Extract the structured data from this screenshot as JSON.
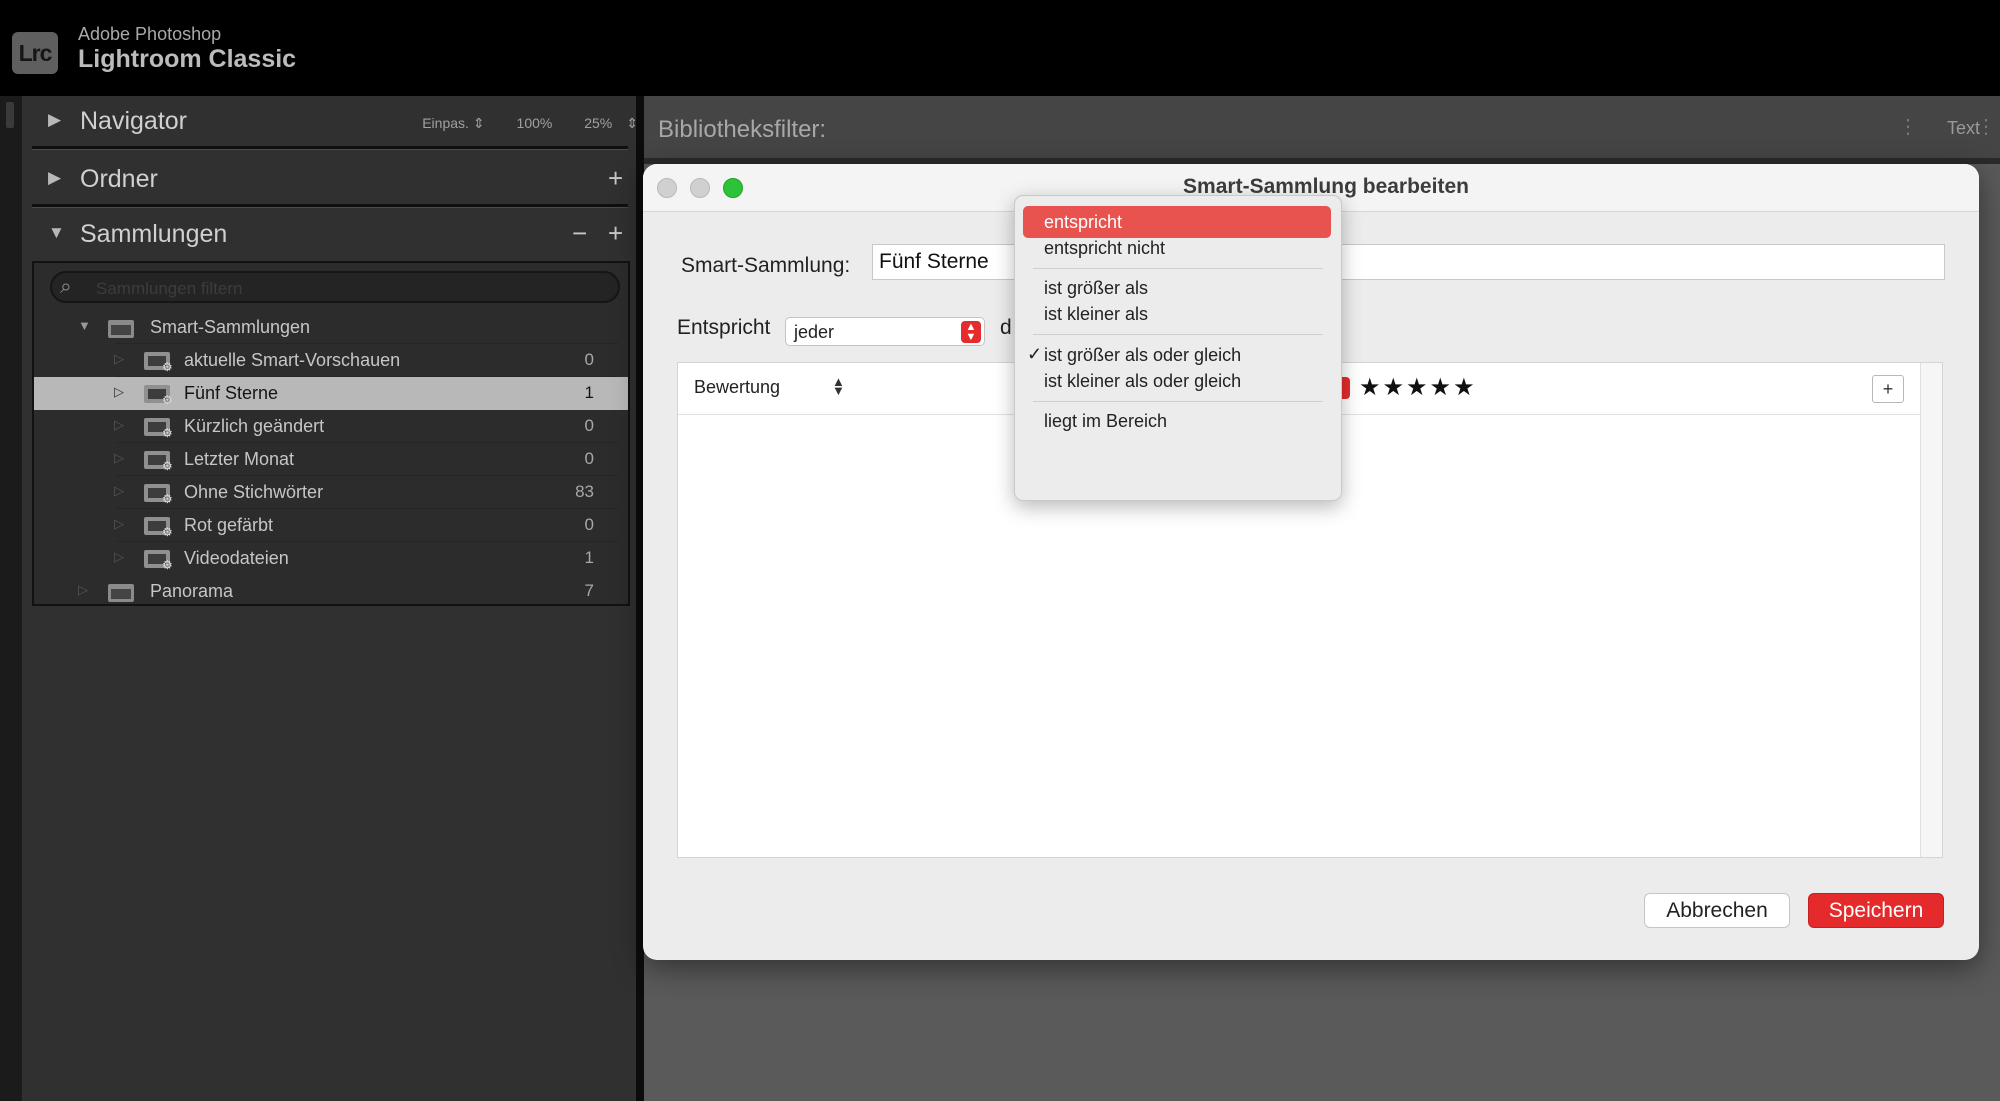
{
  "app": {
    "brand_line1": "Adobe Photoshop",
    "brand_line2": "Lightroom Classic",
    "logo_text": "Lrc"
  },
  "left_panel": {
    "navigator": {
      "title": "Navigator",
      "options": [
        "Einpas.",
        "100%",
        "25%"
      ]
    },
    "folders": {
      "title": "Ordner"
    },
    "collections": {
      "title": "Sammlungen",
      "filter_placeholder": "Sammlungen filtern",
      "items": [
        {
          "label": "Smart-Sammlungen",
          "count": "",
          "type": "set"
        },
        {
          "label": "aktuelle Smart-Vorschauen",
          "count": "0",
          "type": "smart"
        },
        {
          "label": "Fünf Sterne",
          "count": "1",
          "type": "smart",
          "selected": true
        },
        {
          "label": "Kürzlich geändert",
          "count": "0",
          "type": "smart"
        },
        {
          "label": "Letzter Monat",
          "count": "0",
          "type": "smart"
        },
        {
          "label": "Ohne Stichwörter",
          "count": "83",
          "type": "smart"
        },
        {
          "label": "Rot gefärbt",
          "count": "0",
          "type": "smart"
        },
        {
          "label": "Videodateien",
          "count": "1",
          "type": "smart"
        },
        {
          "label": "Panorama",
          "count": "7",
          "type": "collection"
        }
      ]
    }
  },
  "filter_bar": {
    "label": "Bibliotheksfilter:",
    "text_tab": "Text"
  },
  "dialog": {
    "title": "Smart-Sammlung bearbeiten",
    "name_label": "Smart-Sammlung:",
    "name_value": "Fünf Sterne",
    "match_label": "Entspricht",
    "match_value": "jeder",
    "match_rest": "d",
    "rule": {
      "field": "Bewertung",
      "stars": "★★★★★",
      "add_label": "+"
    },
    "cancel_label": "Abbrechen",
    "save_label": "Speichern"
  },
  "operator_menu": {
    "items": [
      {
        "label": "entspricht",
        "active": true
      },
      {
        "label": "entspricht nicht"
      },
      {
        "label": "ist größer als"
      },
      {
        "label": "ist kleiner als"
      },
      {
        "label": "ist größer als oder gleich",
        "checked": true
      },
      {
        "label": "ist kleiner als oder gleich"
      },
      {
        "label": "liegt im Bereich"
      }
    ]
  },
  "colors": {
    "accent_red": "#e42a2a",
    "menu_highlight": "#e8524f",
    "selection_row": "#b8b8b8",
    "traffic_green": "#2cc33a"
  }
}
